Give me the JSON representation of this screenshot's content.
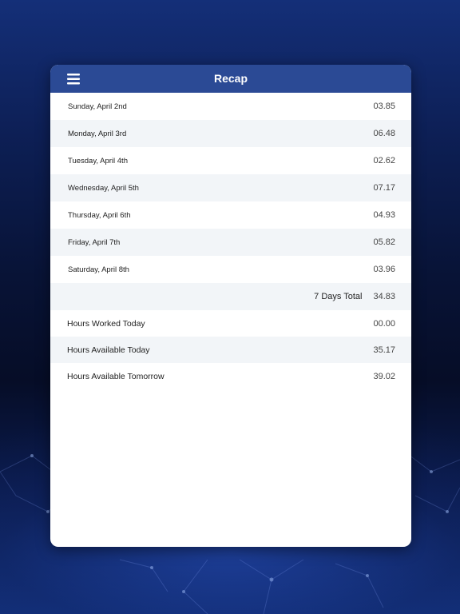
{
  "header": {
    "title": "Recap"
  },
  "days": [
    {
      "label": "Sunday, April 2nd",
      "value": "03.85"
    },
    {
      "label": "Monday, April 3rd",
      "value": "06.48"
    },
    {
      "label": "Tuesday, April 4th",
      "value": "02.62"
    },
    {
      "label": "Wednesday, April 5th",
      "value": "07.17"
    },
    {
      "label": "Thursday, April 6th",
      "value": "04.93"
    },
    {
      "label": "Friday, April 7th",
      "value": "05.82"
    },
    {
      "label": "Saturday, April 8th",
      "value": "03.96"
    }
  ],
  "total": {
    "label": "7 Days Total",
    "value": "34.83"
  },
  "stats": [
    {
      "label": "Hours Worked Today",
      "value": "00.00"
    },
    {
      "label": "Hours Available Today",
      "value": "35.17"
    },
    {
      "label": "Hours Available Tomorrow",
      "value": "39.02"
    }
  ],
  "colors": {
    "header": "#2b4a95",
    "alt_row": "#f2f5f8",
    "background_dark": "#060d27",
    "background_blue": "#142f78"
  },
  "icons": {
    "menu": "hamburger-menu-icon"
  }
}
